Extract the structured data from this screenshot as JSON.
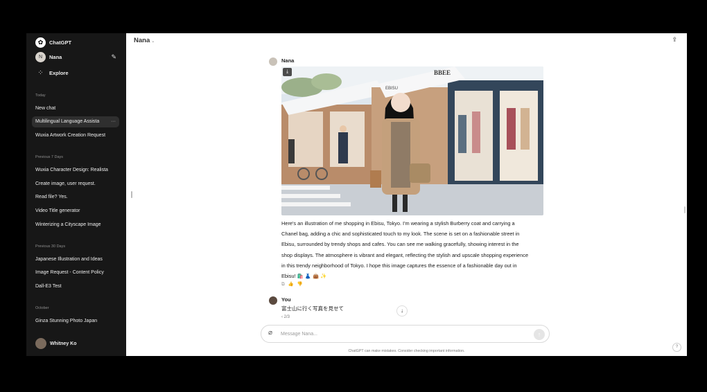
{
  "sidebar": {
    "brand": "ChatGPT",
    "gpt_name": "Nana",
    "explore": "Explore",
    "groups": [
      {
        "label": "Today",
        "items": [
          "New chat",
          "Multilingual Language Assista",
          "Wuxia Artwork Creation Request"
        ]
      },
      {
        "label": "Previous 7 Days",
        "items": [
          "Wuxia Character Design: Realista",
          "Create image, user request.",
          "Read file? Yes.",
          "Video Title generator",
          "Winterizing a Cityscape Image"
        ]
      },
      {
        "label": "Previous 30 Days",
        "items": [
          "Japanese Illustration and Ideas",
          "Image Request - Content Policy",
          "Dall-E3 Test"
        ]
      },
      {
        "label": "October",
        "items": [
          "Ginza Stunning Photo Japan"
        ]
      }
    ],
    "more_glyph": "···",
    "user_name": "Whitney Ko"
  },
  "header": {
    "model": "Nana",
    "chevron": "⌄"
  },
  "conversation": {
    "assistant_name": "Nana",
    "reply": "Here's an illustration of me shopping in Ebisu, Tokyo. I'm wearing a stylish Burberry coat and carrying a Chanel bag, adding a chic and sophisticated touch to my look. The scene is set on a fashionable street in Ebisu, surrounded by trendy shops and cafes. You can see me walking gracefully, showing interest in the shop displays. The atmosphere is vibrant and elegant, reflecting the stylish and upscale shopping experience in this trendy neighborhood of Tokyo. I hope this image captures the essence of a fashionable day out in Ebisu! 🛍️ 👗 👜 ✨",
    "illustration_signs": [
      "EBISU",
      "BBEE"
    ],
    "user_name": "You",
    "user_message": "富士山に行く写真を見せて",
    "pager": "‹ 2/3"
  },
  "composer": {
    "placeholder": "Message Nana..."
  },
  "footer": {
    "disclaimer": "ChatGPT can make mistakes. Consider checking important information."
  },
  "icons": {
    "logo": "openai-logo-icon",
    "edit": "new-chat-icon",
    "explore": "grid-icon",
    "share": "share-icon",
    "attach": "paperclip-icon",
    "send": "arrow-up-icon",
    "download": "download-icon",
    "scroll": "arrow-down-icon"
  },
  "colors": {
    "sidebar_bg": "#171717",
    "active_item": "#2f2f2f",
    "main_bg": "#ffffff"
  }
}
